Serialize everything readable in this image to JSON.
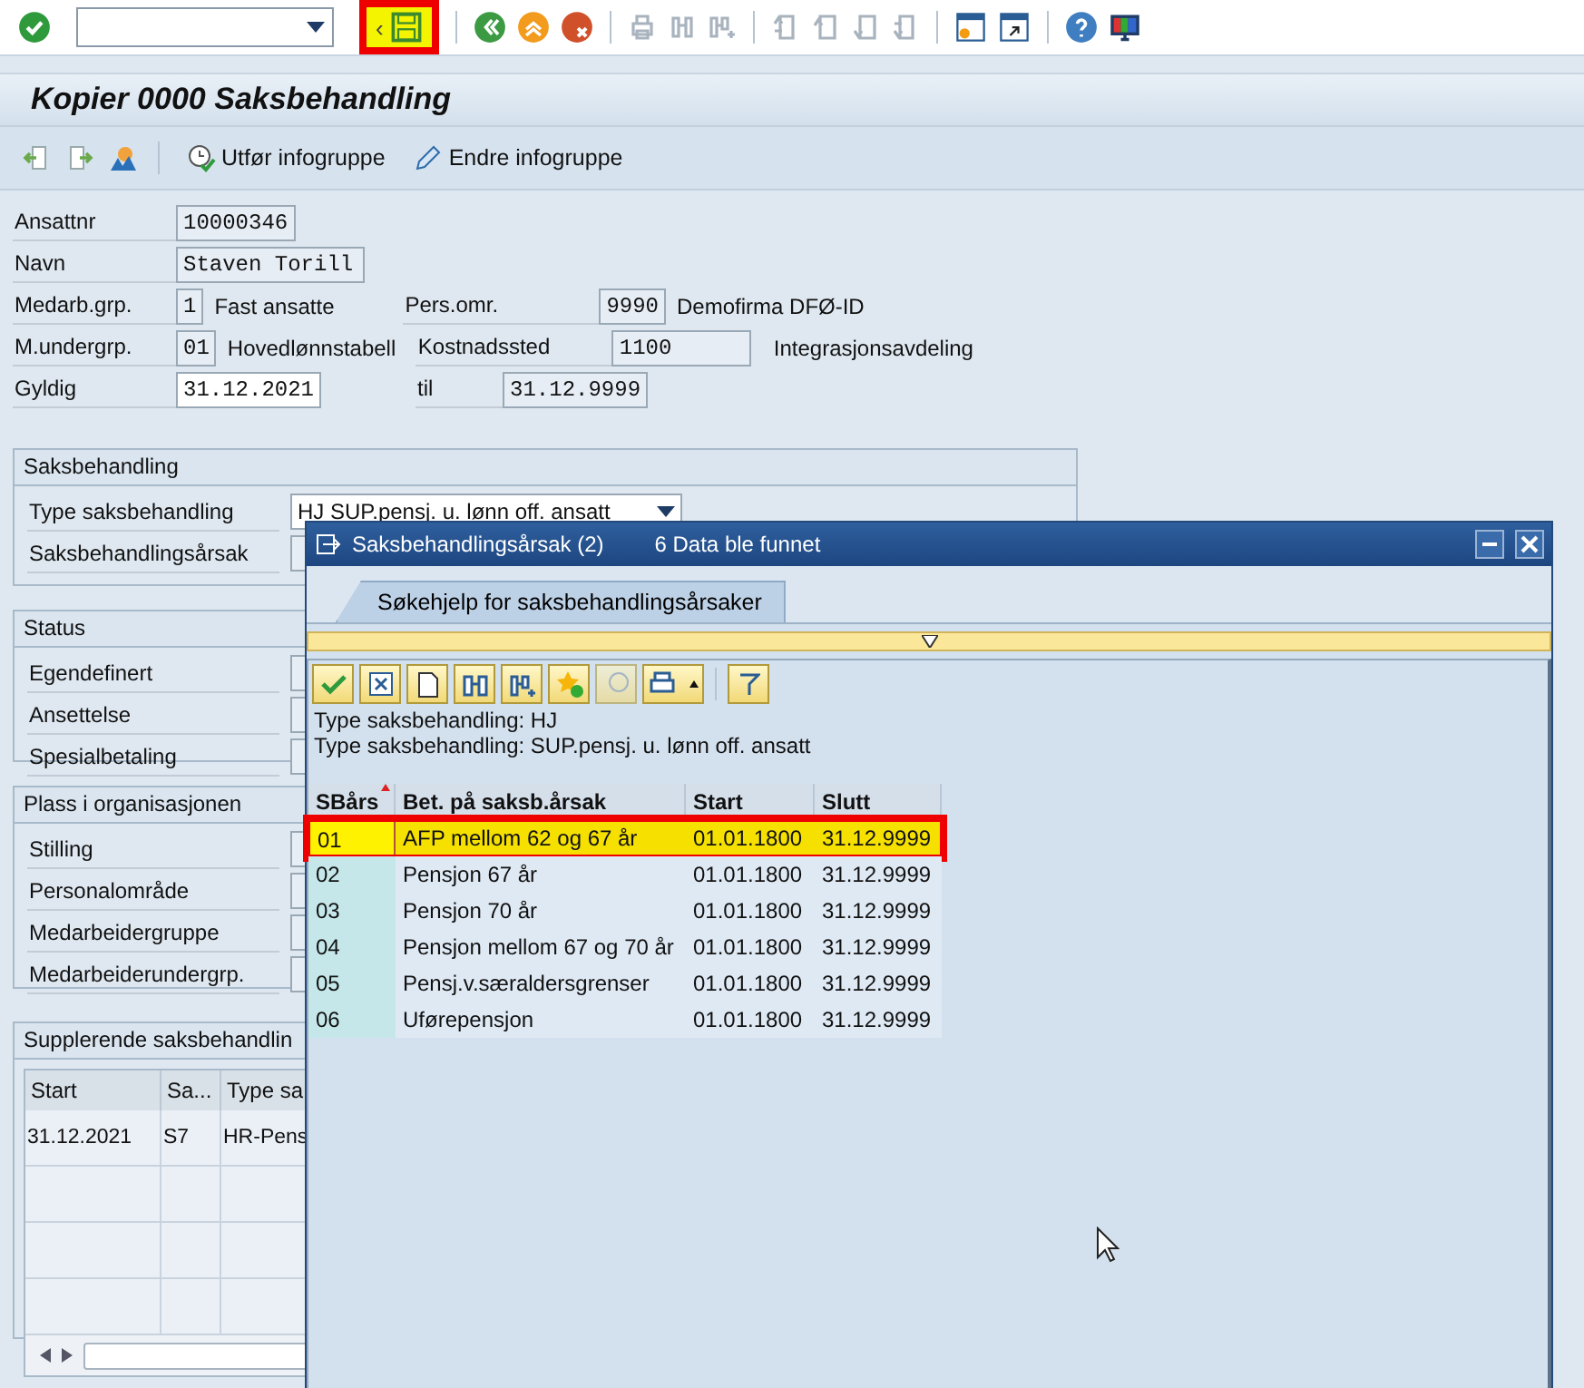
{
  "toolbar": {
    "collapse_marker": "‹"
  },
  "title": "Kopier 0000 Saksbehandling",
  "app_toolbar": [
    "Utfør infogruppe",
    "Endre infogruppe"
  ],
  "header": [
    {
      "label": "Ansattnr",
      "value": "10000346",
      "editable": false
    },
    {
      "label": "Navn",
      "value": "Staven Torill",
      "editable": false
    },
    {
      "label": "Medarb.grp.",
      "value": "1",
      "editable": false,
      "text": "Fast ansatte",
      "right": {
        "label": "Pers.omr.",
        "value": "9990",
        "text": "Demofirma DFØ-ID"
      }
    },
    {
      "label": "M.undergrp.",
      "value": "01",
      "editable": false,
      "text": "Hovedlønnstabell",
      "right": {
        "label": "Kostnadssted",
        "value": "1100",
        "text": "Integrasjonsavdeling"
      }
    },
    {
      "label": "Gyldig",
      "value": "31.12.2021",
      "editable": true,
      "right": {
        "label": "til",
        "value": "31.12.9999"
      }
    }
  ],
  "groups": [
    {
      "title": "Saksbehandling",
      "fields": [
        {
          "label": "Type saksbehandling",
          "kind": "dropdown",
          "value": "HJ SUP.pensj. u. lønn off. ansatt"
        },
        {
          "label": "Saksbehandlingsårsak",
          "kind": "field"
        }
      ]
    },
    {
      "title": "Status",
      "fields": [
        {
          "label": "Egendefinert",
          "kind": "field"
        },
        {
          "label": "Ansettelse",
          "kind": "field"
        },
        {
          "label": "Spesialbetaling",
          "kind": "field"
        }
      ]
    },
    {
      "title": "Plass i organisasjonen",
      "fields": [
        {
          "label": "Stilling",
          "kind": "field"
        },
        {
          "label": "Personalområde",
          "kind": "field"
        },
        {
          "label": "Medarbeidergruppe",
          "kind": "field"
        },
        {
          "label": "Medarbeiderundergrp.",
          "kind": "field"
        }
      ]
    }
  ],
  "supplementary": {
    "title": "Supplerende saksbehandlin",
    "columns": [
      "Start",
      "Sa...",
      "Type sa"
    ],
    "rows": [
      [
        "31.12.2021",
        "S7",
        "HR-Pens"
      ]
    ]
  },
  "dialog": {
    "title": "Saksbehandlingsårsak (2)",
    "subtitle": "6 Data ble funnet",
    "tab": "Søkehjelp for saksbehandlingsårsaker",
    "info": [
      "Type saksbehandling: HJ",
      "Type saksbehandling: SUP.pensj. u. lønn off. ansatt"
    ],
    "columns": [
      "SBårs",
      "Bet. på saksb.årsak",
      "Start",
      "Slutt"
    ],
    "rows": [
      {
        "cells": [
          "01",
          "AFP mellom 62 og 67 år",
          "01.01.1800",
          "31.12.9999"
        ],
        "selected": true
      },
      {
        "cells": [
          "02",
          "Pensjon 67 år",
          "01.01.1800",
          "31.12.9999"
        ],
        "selected": false
      },
      {
        "cells": [
          "03",
          "Pensjon 70 år",
          "01.01.1800",
          "31.12.9999"
        ],
        "selected": false
      },
      {
        "cells": [
          "04",
          "Pensjon mellom 67 og 70 år",
          "01.01.1800",
          "31.12.9999"
        ],
        "selected": false
      },
      {
        "cells": [
          "05",
          "Pensj.v.særaldersgrenser",
          "01.01.1800",
          "31.12.9999"
        ],
        "selected": false
      },
      {
        "cells": [
          "06",
          "Uførepensjon",
          "01.01.1800",
          "31.12.9999"
        ],
        "selected": false
      }
    ]
  }
}
